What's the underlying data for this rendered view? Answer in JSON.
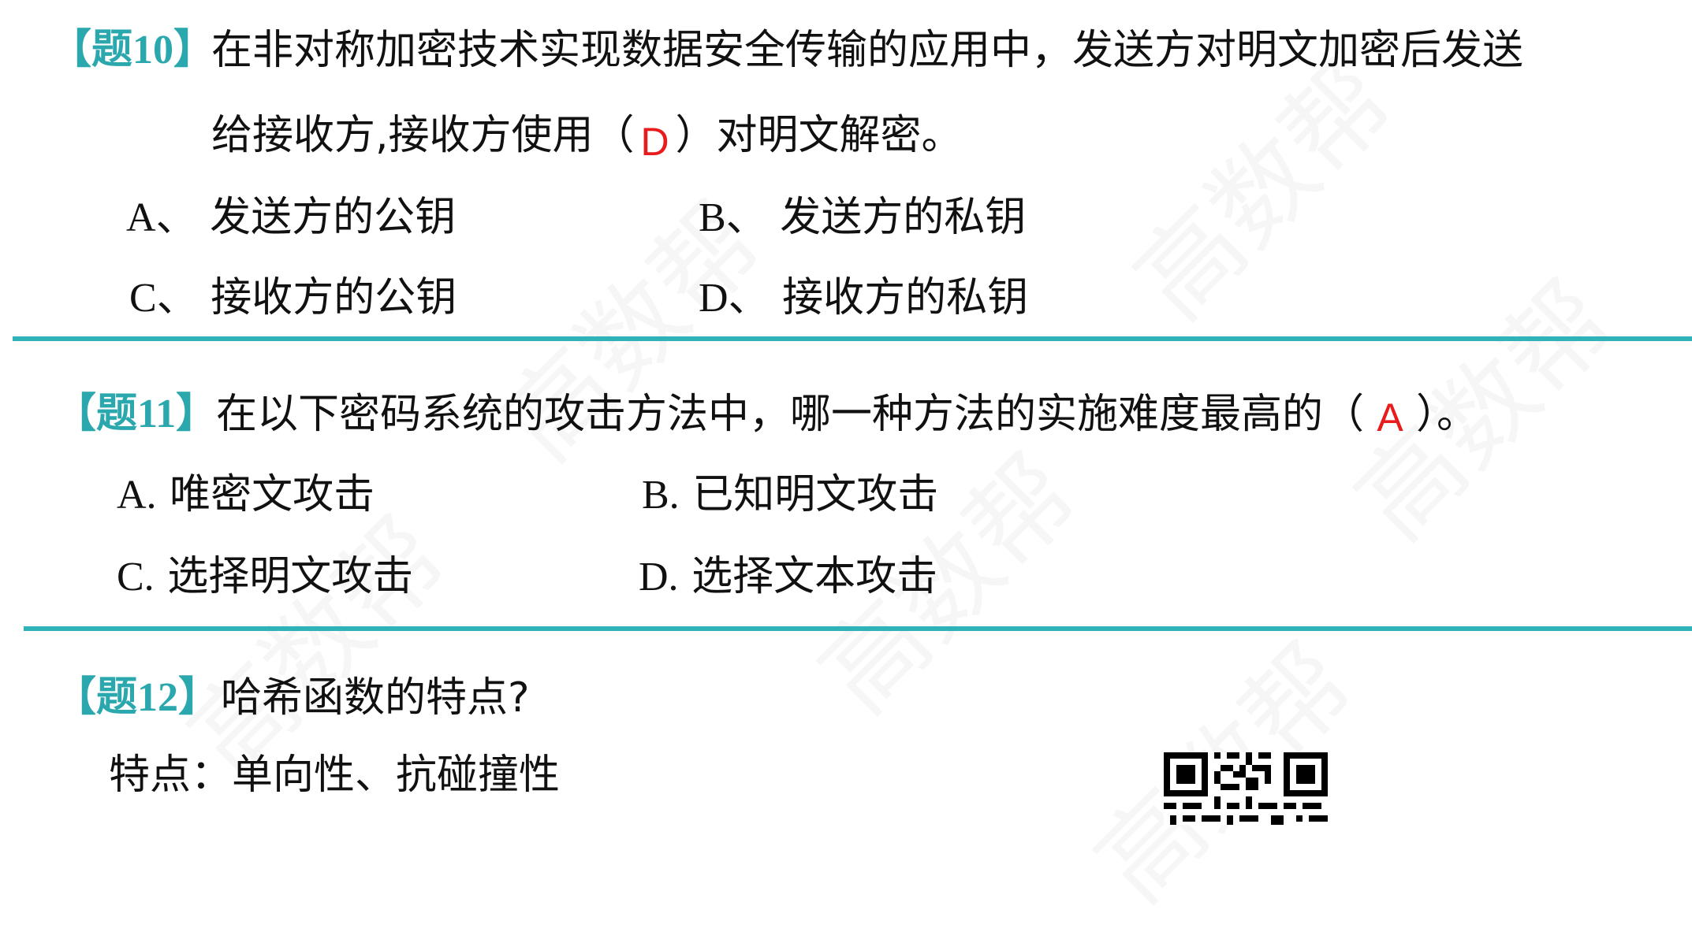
{
  "q10": {
    "number": "【题10】",
    "line1": "在非对称加密技术实现数据安全传输的应用中，发送方对明文加密后发送",
    "line2_pre": "给接收方,接收方使用（",
    "answer": "D",
    "line2_post": "）对明文解密。",
    "options": [
      {
        "letter": "A、",
        "text": "发送方的公钥"
      },
      {
        "letter": "B、",
        "text": "发送方的私钥"
      },
      {
        "letter": "C、",
        "text": "接收方的公钥"
      },
      {
        "letter": "D、",
        "text": "接收方的私钥"
      }
    ]
  },
  "q11": {
    "number": "【题11】",
    "line_pre": "在以下密码系统的攻击方法中，哪一种方法的实施难度最高的（",
    "answer": "A",
    "line_post": "）。",
    "options": [
      {
        "letter": "A.",
        "text": "唯密文攻击"
      },
      {
        "letter": "B.",
        "text": "已知明文攻击"
      },
      {
        "letter": "C.",
        "text": "选择明文攻击"
      },
      {
        "letter": "D.",
        "text": "选择文本攻击"
      }
    ]
  },
  "q12": {
    "number": "【题12】",
    "question": "哈希函数的特点?",
    "answer_line": "特点：单向性、抗碰撞性"
  },
  "watermark": "高数帮",
  "colors": {
    "question_number": "#2aa8ad",
    "divider": "#2fb3b8",
    "answer": "#e81c1c",
    "text": "#111111"
  },
  "icons": {
    "qr": "qr-code-icon"
  }
}
